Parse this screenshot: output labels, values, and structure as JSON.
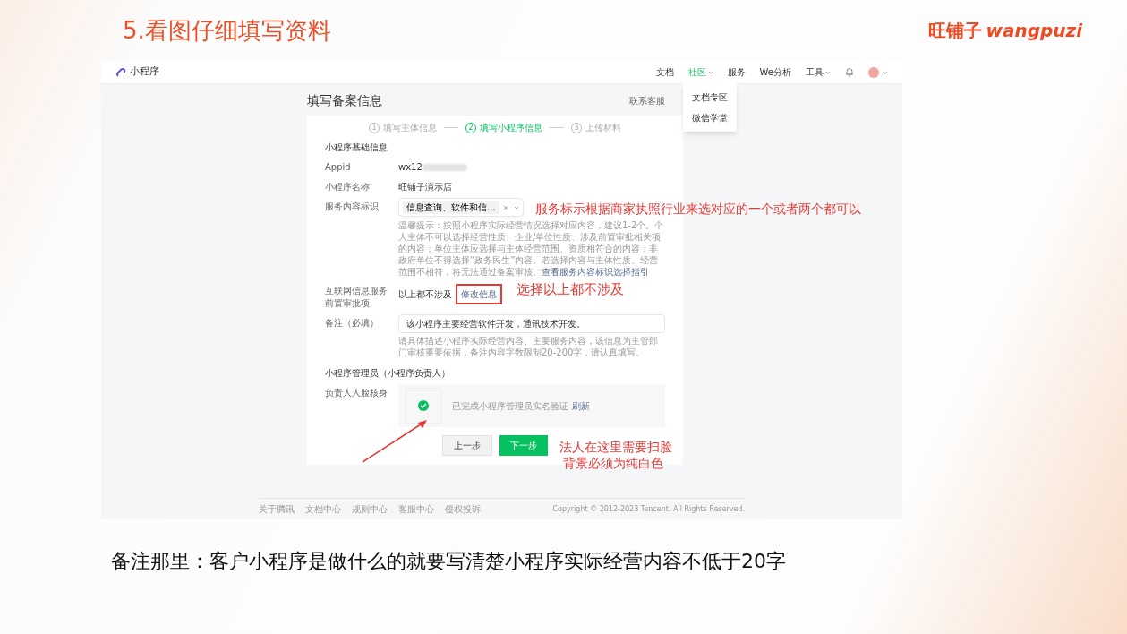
{
  "slide": {
    "title": "5.看图仔细填写资料",
    "logo": {
      "cn": "旺铺子",
      "en": "wangpuzi"
    },
    "caption": "备注那里：客户小程序是做什么的就要写清楚小程序实际经营内容不低于20字"
  },
  "screenshot": {
    "app_name": "小程序",
    "nav": [
      {
        "label": "文档",
        "dropdown": false,
        "selected": false
      },
      {
        "label": "社区",
        "dropdown": true,
        "selected": true
      },
      {
        "label": "服务",
        "dropdown": false,
        "selected": false
      },
      {
        "label": "We分析",
        "dropdown": false,
        "selected": false
      },
      {
        "label": "工具",
        "dropdown": true,
        "selected": false
      }
    ],
    "menu": [
      "文档专区",
      "微信学堂"
    ],
    "page_title": "填写备案信息",
    "contact": "联系客服",
    "steps": [
      {
        "number": "1",
        "label": "填写主体信息",
        "selected": false
      },
      {
        "number": "2",
        "label": "填写小程序信息",
        "selected": true
      },
      {
        "number": "3",
        "label": "上传材料",
        "selected": false
      }
    ],
    "section_basic": "小程序基础信息",
    "appid": {
      "label": "Appid",
      "value": "wx12"
    },
    "name": {
      "label": "小程序名称",
      "value": "旺铺子演示店"
    },
    "service": {
      "label": "服务内容标识",
      "tag": "信息查询、软件和信...",
      "tip": "温馨提示：按照小程序实际经营情况选择对应内容，建议1-2个。个人主体不可以选择经营性质、企业/单位性质、涉及前置审批相关项的内容；单位主体应选择与主体经营范围、资质相符合的内容；非政府单位不得选择“政务民生”内容。若选择内容与主体性质、经营范围不相符，将无法通过备案审核。",
      "tip_link": "查看服务内容标识选择指引"
    },
    "permit": {
      "label": "互联网信息服务前置审批项",
      "value": "以上都不涉及",
      "link": "修改信息",
      "highlighted": true
    },
    "remark": {
      "label": "备注（必填）",
      "value": "该小程序主要经营软件开发，通讯技术开发。",
      "hint": "请具体描述小程序实际经营内容、主要服务内容，该信息为主管部门审核重要依据，备注内容字数限制20-200字，请认真填写。"
    },
    "section_admin": "小程序管理员（小程序负责人）",
    "face": {
      "label": "负责人人脸核身",
      "verified": true,
      "status": "已完成小程序管理员实名验证",
      "link": "刷新"
    },
    "buttons": {
      "prev": "上一步",
      "next": "下一步"
    },
    "footer_links": [
      "关于腾讯",
      "文档中心",
      "规则中心",
      "客服中心",
      "侵权投诉"
    ],
    "copyright": "Copyright © 2012-2023 Tencent. All Rights Reserved."
  },
  "annotations": [
    {
      "kind": "single",
      "lines": [
        "服务标示根据商家执照行业来选对应的一个或者两个都可以"
      ]
    },
    {
      "kind": "single",
      "lines": [
        "选择以上都不涉及"
      ]
    },
    {
      "kind": "arrow",
      "lines": [
        "法人在这里需要扫脸",
        "背景必须为纯白色"
      ]
    }
  ]
}
